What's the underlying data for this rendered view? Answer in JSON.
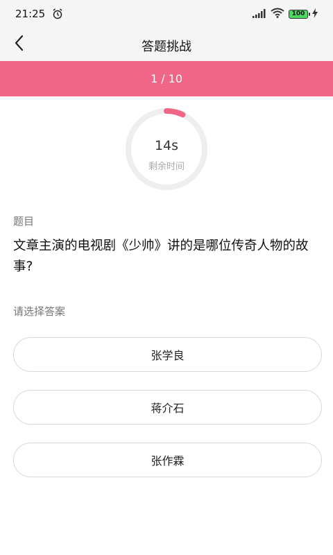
{
  "status_bar": {
    "time": "21:25",
    "battery": "100",
    "icons": [
      "alarm-icon",
      "signal-icon",
      "wifi-icon",
      "battery-icon",
      "charging-icon"
    ]
  },
  "nav": {
    "title": "答题挑战",
    "back_icon": "chevron-left-icon"
  },
  "progress": {
    "text": "1 / 10",
    "current": 1,
    "total": 10
  },
  "timer": {
    "value": "14s",
    "label": "剩余时间",
    "remaining_fraction": 0.07
  },
  "question": {
    "label": "题目",
    "text": "文章主演的电视剧《少帅》讲的是哪位传奇人物的故事?"
  },
  "answers": {
    "label": "请选择答案",
    "options": [
      "张学良",
      "蒋介石",
      "张作霖"
    ]
  },
  "colors": {
    "accent": "#f06686",
    "ring_track": "#eeeeee",
    "ring_progress": "#f06686",
    "option_border": "#d8d8d8"
  }
}
